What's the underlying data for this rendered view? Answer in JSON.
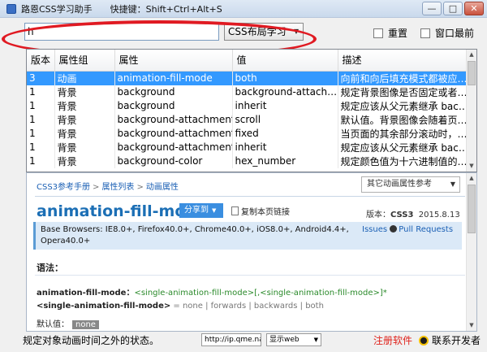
{
  "window": {
    "title": "路恩CSS学习助手",
    "hotkey": "快捷键：Shift+Ctrl+Alt+S",
    "buttons": [
      "—",
      "□",
      "✕"
    ]
  },
  "toolbar": {
    "search_value": "h",
    "category_selected": "CSS布局学习",
    "checkbox_reset": "重置",
    "checkbox_topmost": "窗口最前"
  },
  "table": {
    "columns": [
      "版本",
      "属性组",
      "属性",
      "值",
      "描述"
    ],
    "rows": [
      [
        "3",
        "动画",
        "animation-fill-mode",
        "both",
        "向前和向后填充模式都被应…"
      ],
      [
        "1",
        "背景",
        "background",
        "background-attach…",
        "规定背景图像是否固定或者…"
      ],
      [
        "1",
        "背景",
        "background",
        "inherit",
        "规定应该从父元素继承 bac…"
      ],
      [
        "1",
        "背景",
        "background-attachment",
        "scroll",
        "默认值。背景图像会随着页…"
      ],
      [
        "1",
        "背景",
        "background-attachment",
        "fixed",
        "当页面的其余部分滚动时，…"
      ],
      [
        "1",
        "背景",
        "background-attachment",
        "inherit",
        "规定应该从父元素继承 bac…"
      ],
      [
        "1",
        "背景",
        "background-color",
        "hex_number",
        "规定颜色值为十六进制值的…"
      ]
    ]
  },
  "doc": {
    "breadcrumb": [
      "CSS3参考手册",
      "属性列表",
      "动画属性"
    ],
    "other_select": "其它动画属性参考",
    "prop_title": "animation-fill-mode",
    "share_label": "分享到",
    "copy_link": "复制本页链接",
    "version_label": "版本：",
    "version_value": "CSS3",
    "version_date": "2015.8.13",
    "compat_line1": "Base Browsers: IE8.0+, Firefox40.0+, Chrome40.0+, iOS8.0+, Android4.4+,",
    "compat_line2": "Opera40.0+",
    "issues_label": "Issues",
    "pull_label": "Pull Requests",
    "syntax_head": "语法：",
    "syntax1_key": "animation-fill-mode：",
    "syntax1_val": "<single-animation-fill-mode>[,<single-animation-fill-mode>]*",
    "syntax2_key": "<single-animation-fill-mode>",
    "syntax2_val": " = none | forwards | backwards | both",
    "default_label": "默认值：",
    "default_value": "none"
  },
  "status": {
    "desc": "规定对象动画时间之外的状态。",
    "url": "http://ip.qme.na",
    "show_select": "显示web",
    "register": "注册软件",
    "contact": "联系开发者"
  }
}
